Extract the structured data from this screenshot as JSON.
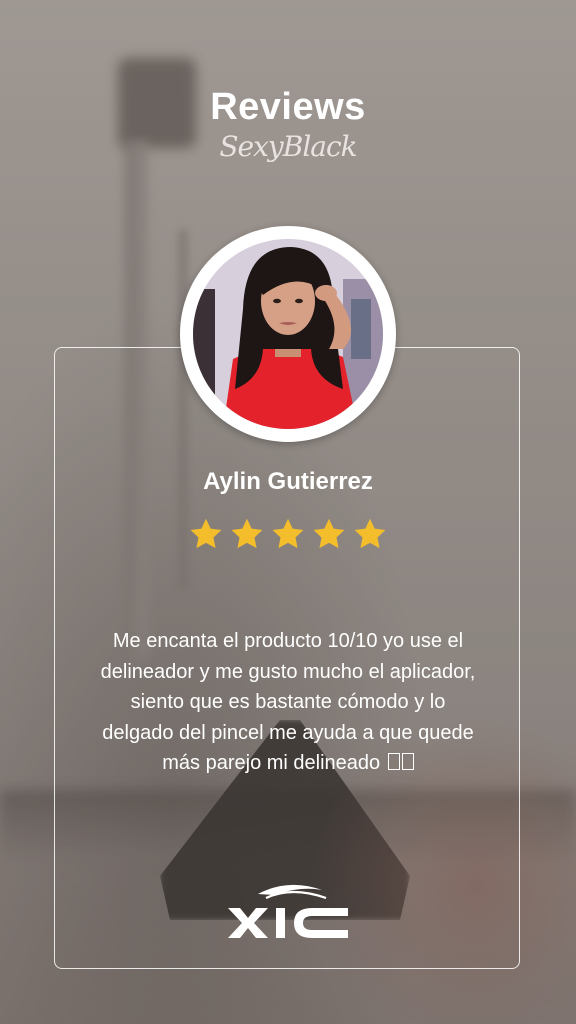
{
  "header": {
    "title": "Reviews",
    "subtitle": "SexyBlack"
  },
  "review": {
    "reviewer_name": "Aylin Gutierrez",
    "rating": 5,
    "rating_max": 5,
    "text": "Me encanta el producto 10/10 yo use el delineador y me gusto mucho el aplicador, siento que es bastante cómodo y lo delgado del pincel me ayuda a que quede más parejo mi delineado"
  },
  "colors": {
    "star": "#f3bd2c",
    "text": "#ffffff",
    "card_border": "#ffffff"
  },
  "icons": {
    "star": "star-icon",
    "logo": "xic-logo"
  }
}
